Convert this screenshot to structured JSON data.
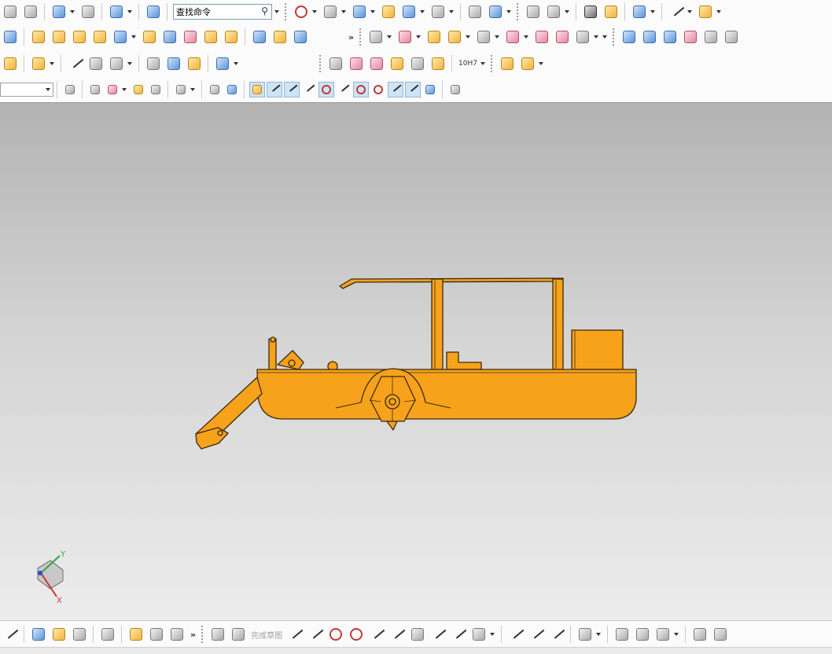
{
  "toolbar_top": {
    "search_placeholder": "查找命令",
    "search_value": "查找命令",
    "more_glyph": "»"
  },
  "toolbar_mid": {
    "more_glyph": "»",
    "tolerance_label": "10H7"
  },
  "toolbar_bottom": {
    "more_glyph": "»",
    "finish_sketch_label": "完成草图"
  },
  "triad": {
    "x_label": "X",
    "y_label": "Y"
  },
  "icons": {
    "new": "new-icon",
    "paste": "paste-icon",
    "undo": "undo-icon",
    "redo": "redo-icon",
    "info": "info-icon",
    "search": "search-icon",
    "extrude": "extrude-icon",
    "snap_point": "snap-point-icon",
    "snap_end": "snap-endpoint-icon",
    "snap_mid": "snap-midpoint-icon",
    "snap_center": "snap-center-icon"
  },
  "colors": {
    "model_fill": "#f7a21b",
    "model_edge": "#3a2a10",
    "viewport_top": "#b3b3b3",
    "viewport_bottom": "#ececec"
  }
}
